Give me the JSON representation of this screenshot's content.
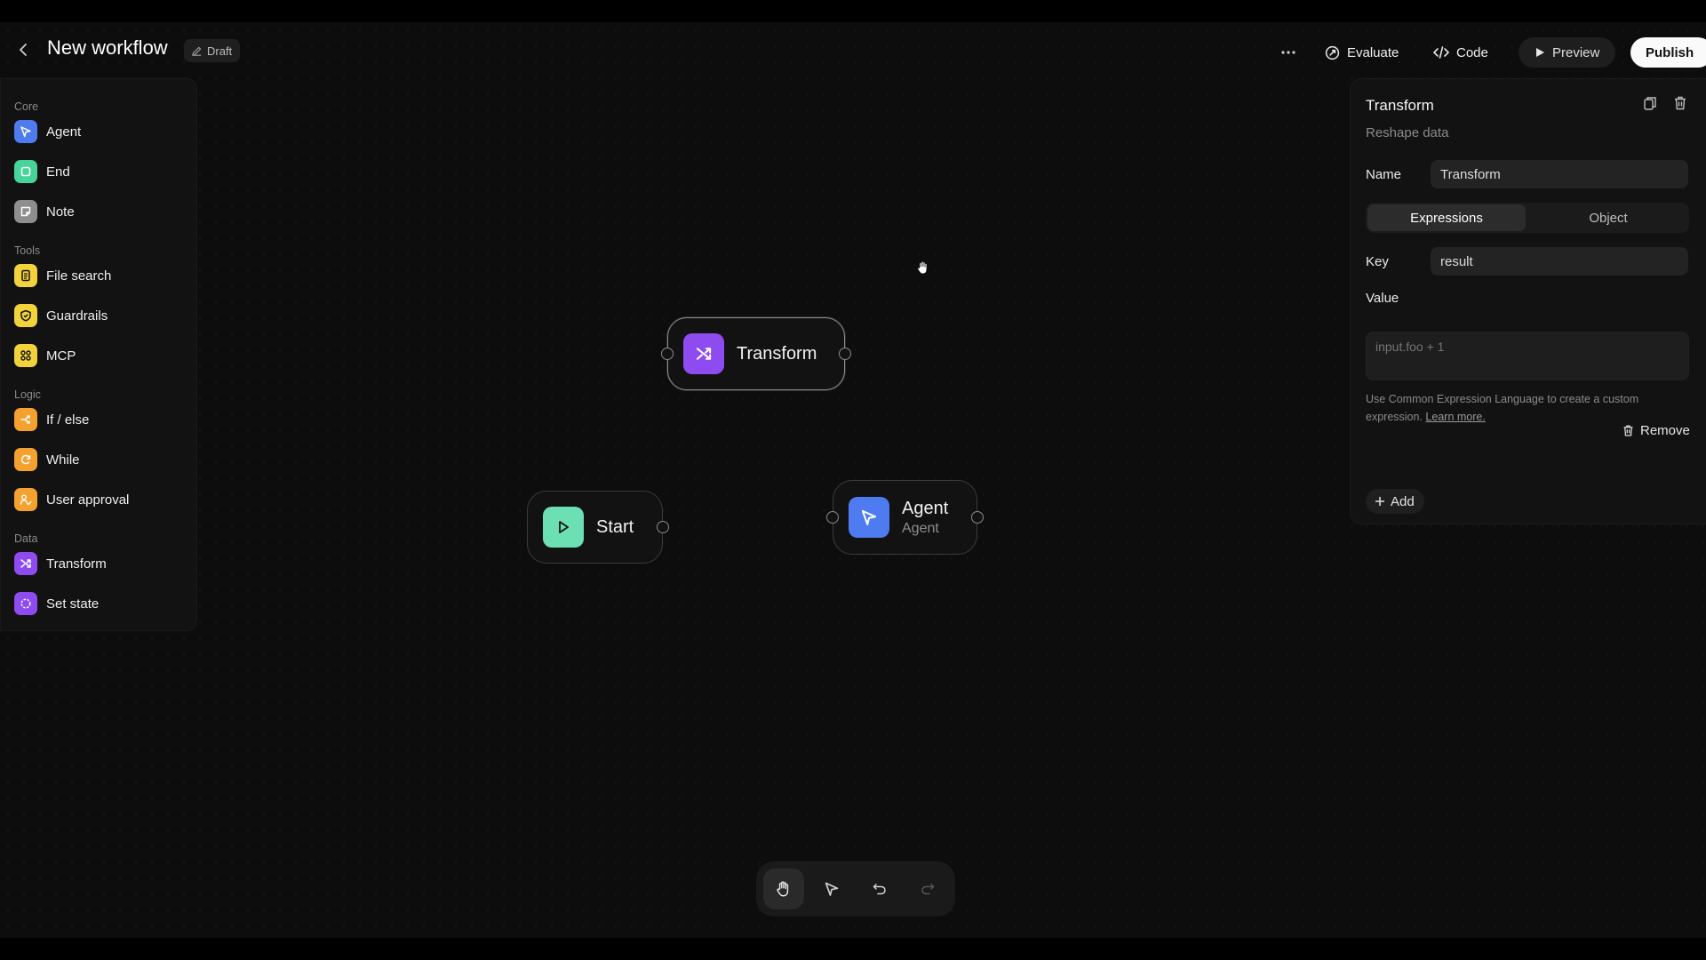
{
  "header": {
    "title": "New workflow",
    "badge": "Draft",
    "evaluate_label": "Evaluate",
    "code_label": "Code",
    "preview_label": "Preview",
    "publish_label": "Publish"
  },
  "sidebar": {
    "sections": [
      {
        "label": "Core",
        "items": [
          {
            "label": "Agent",
            "icon": "agent-icon",
            "color": "#4f7bf0"
          },
          {
            "label": "End",
            "icon": "end-icon",
            "color": "#47d39a"
          },
          {
            "label": "Note",
            "icon": "note-icon",
            "color": "#8e8e8e"
          }
        ]
      },
      {
        "label": "Tools",
        "items": [
          {
            "label": "File search",
            "icon": "file-search-icon",
            "color": "#f2d33c"
          },
          {
            "label": "Guardrails",
            "icon": "guardrails-icon",
            "color": "#f2d33c"
          },
          {
            "label": "MCP",
            "icon": "mcp-icon",
            "color": "#f2d33c"
          }
        ]
      },
      {
        "label": "Logic",
        "items": [
          {
            "label": "If / else",
            "icon": "if-else-icon",
            "color": "#f4a12f"
          },
          {
            "label": "While",
            "icon": "while-icon",
            "color": "#f4a12f"
          },
          {
            "label": "User approval",
            "icon": "user-approval-icon",
            "color": "#f4a12f"
          }
        ]
      },
      {
        "label": "Data",
        "items": [
          {
            "label": "Transform",
            "icon": "transform-icon",
            "color": "#8e4cf0"
          },
          {
            "label": "Set state",
            "icon": "set-state-icon",
            "color": "#8e4cf0"
          }
        ]
      }
    ]
  },
  "canvas": {
    "nodes": {
      "transform": {
        "label": "Transform",
        "icon": "transform-icon",
        "color": "#8e4cf0"
      },
      "start": {
        "label": "Start",
        "icon": "play-icon",
        "color": "#6ce0b3"
      },
      "agent": {
        "label": "Agent",
        "sublabel": "Agent",
        "icon": "agent-icon",
        "color": "#4f7bf0"
      }
    }
  },
  "panel": {
    "title": "Transform",
    "subtitle": "Reshape data",
    "name_label": "Name",
    "name_value": "Transform",
    "tabs": [
      "Expressions",
      "Object"
    ],
    "active_tab": "Expressions",
    "key_label": "Key",
    "key_value": "result",
    "value_label": "Value",
    "value_placeholder": "input.foo + 1",
    "help_text": "Use Common Expression Language to create a custom expression.",
    "help_link": "Learn more.",
    "remove_label": "Remove",
    "add_label": "Add"
  },
  "toolbar": {
    "tools": [
      "pan",
      "select",
      "undo",
      "redo"
    ],
    "active_tool": "pan"
  }
}
